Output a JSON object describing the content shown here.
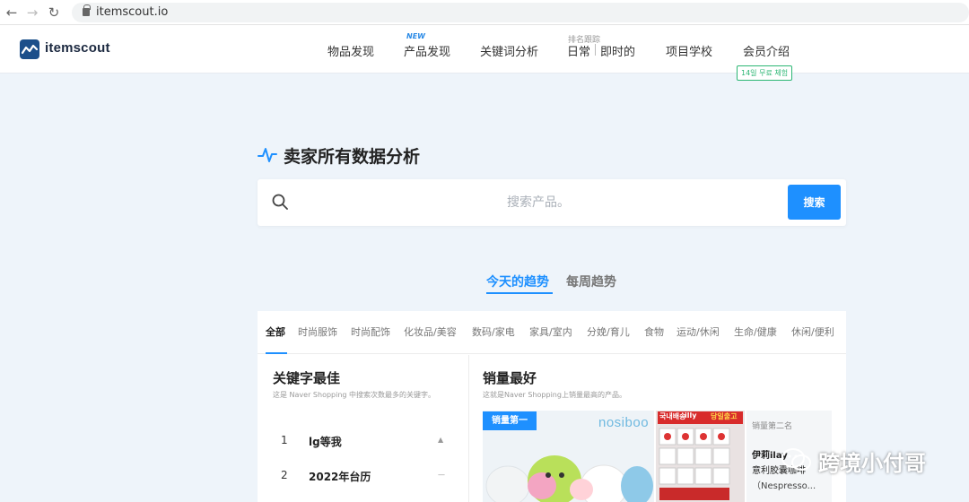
{
  "browser": {
    "back_icon": "arrow-left-icon",
    "forward_icon": "arrow-right-icon",
    "reload_icon": "reload-icon",
    "url": "itemscout.io"
  },
  "header": {
    "logo_text": "itemscout",
    "menu": {
      "item_discovery": "物品发现",
      "product_discovery": "产品发现",
      "new_tag": "NEW",
      "keyword_analysis": "关键词分析",
      "rank_tracking": "排名跟踪",
      "daily": "日常",
      "realtime": "即时的",
      "project_school": "项目学校",
      "membership": "会员介绍",
      "trial_badge": "14일 무료 체험"
    }
  },
  "hero": {
    "title": "卖家所有数据分析",
    "search_placeholder": "搜索产品。",
    "search_button": "搜索"
  },
  "trends": {
    "today": "今天的趋势",
    "weekly": "每周趋势"
  },
  "categories": [
    "全部",
    "时尚服饰",
    "时尚配饰",
    "化妆品/美容",
    "数码/家电",
    "家具/室内",
    "分娩/育儿",
    "食物",
    "运动/休闲",
    "生命/健康",
    "休闲/便利"
  ],
  "keywords_section": {
    "title": "关键字最佳",
    "desc": "这是 Naver Shopping 中搜索次数最多的关键字。",
    "rows": [
      {
        "rank": "1",
        "name": "lg等我"
      },
      {
        "rank": "2",
        "name": "2022年台历"
      }
    ]
  },
  "bestsellers": {
    "title": "销量最好",
    "desc": "这就是Naver Shopping上销量最高的产品。",
    "first_badge": "销量第一",
    "first_brand": "nosiboo",
    "second_banner": [
      "국내배송",
      "illy",
      "당일출고"
    ],
    "second_label": "销量第二名",
    "second_name_1": "伊莉ilay",
    "second_name_2": "意利胶囊咖啡",
    "second_name_3": "（Nespresso..."
  },
  "watermark": {
    "text": "跨境小付哥"
  }
}
